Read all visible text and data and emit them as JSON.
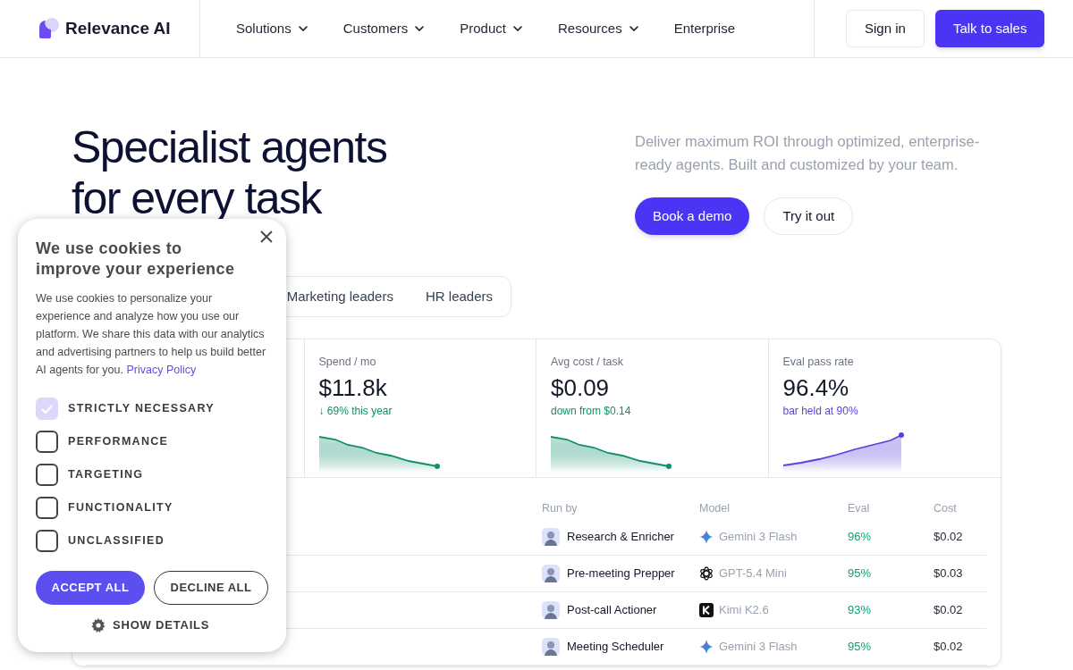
{
  "nav": {
    "brand": "Relevance AI",
    "links": [
      {
        "label": "Solutions",
        "dropdown": true
      },
      {
        "label": "Customers",
        "dropdown": true
      },
      {
        "label": "Product",
        "dropdown": true
      },
      {
        "label": "Resources",
        "dropdown": true
      },
      {
        "label": "Enterprise",
        "dropdown": false
      }
    ],
    "sign_in": "Sign in",
    "cta": "Talk to sales"
  },
  "hero": {
    "title": "Specialist agents for every task",
    "subtitle": "Deliver maximum ROI through optimized, enterprise-ready agents. Built and customized by your team.",
    "primary": "Book a demo",
    "secondary": "Try it out"
  },
  "tabs": [
    {
      "label": "Marketing leaders",
      "selected": false
    },
    {
      "label": "HR leaders",
      "selected": false
    }
  ],
  "stats": [
    {
      "label": "Spend / mo",
      "value": "$11.8k",
      "note": "↓ 69% this year",
      "color": "#0f8f6e",
      "kind": "falling"
    },
    {
      "label": "Avg cost / task",
      "value": "$0.09",
      "note": "down from $0.14",
      "color": "#0f8f6e",
      "kind": "falling"
    },
    {
      "label": "Eval pass rate",
      "value": "96.4%",
      "note": "bar held at 90%",
      "color": "#5b3fe0",
      "kind": "rising"
    }
  ],
  "table": {
    "columns": [
      "Run by",
      "Model",
      "Eval",
      "Cost"
    ],
    "rows": [
      {
        "run_by": "Research & Enricher",
        "model": "Gemini 3 Flash",
        "kind": "star",
        "eval": "96%",
        "cost": "$0.02"
      },
      {
        "run_by": "Pre-meeting Prepper",
        "model": "GPT-5.4 Mini",
        "kind": "knot",
        "eval": "95%",
        "cost": "$0.03"
      },
      {
        "run_by": "Post-call Actioner",
        "model": "Kimi K2.6",
        "kind": "square",
        "eval": "93%",
        "cost": "$0.02"
      },
      {
        "run_by": "Meeting Scheduler",
        "model": "Gemini 3 Flash",
        "kind": "star",
        "eval": "95%",
        "cost": "$0.02"
      }
    ]
  },
  "cookie": {
    "title": "We use cookies to improve your experience",
    "body": "We use cookies to personalize your experience and analyze how you use our platform. We share this data with our analytics and advertising partners to help us build better AI agents for you.",
    "link": "Privacy Policy",
    "options": [
      {
        "label": "STRICTLY NECESSARY",
        "checked": true,
        "disabled": true
      },
      {
        "label": "PERFORMANCE",
        "checked": false,
        "disabled": false
      },
      {
        "label": "TARGETING",
        "checked": false,
        "disabled": false
      },
      {
        "label": "FUNCTIONALITY",
        "checked": false,
        "disabled": false
      },
      {
        "label": "UNCLASSIFIED",
        "checked": false,
        "disabled": false
      }
    ],
    "accept": "ACCEPT ALL",
    "decline": "DECLINE ALL",
    "details": "SHOW DETAILS"
  }
}
